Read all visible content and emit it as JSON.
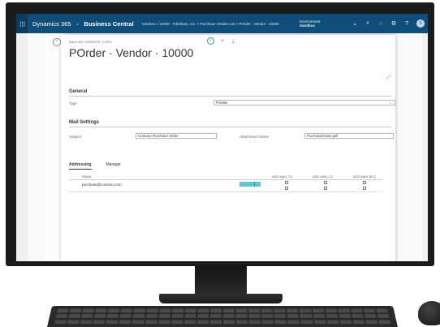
{
  "app": {
    "brand": "Dynamics 365",
    "product": "Business Central",
    "breadcrumb": "Vendors > 10000 · Fabrikam, Inc. > Purchase Vendor List > POrder · Vendor · 10000",
    "company_label": "Environment",
    "company": "Sandbox",
    "avatar_initial": "S"
  },
  "card": {
    "caption": "MAILING VENDOR CARD",
    "title": "POrder · Vendor · 10000"
  },
  "general": {
    "heading": "General",
    "type_label": "Type",
    "type_value": "POrder"
  },
  "mail_settings": {
    "heading": "Mail Settings",
    "subject_label": "Subject",
    "subject_value": "Contoso Purchase Order",
    "attachment_label": "Attachment Name",
    "attachment_value": "PurchaseOrder.pdf"
  },
  "tabs": [
    {
      "label": "Addressing"
    },
    {
      "label": "Manage"
    }
  ],
  "addressing_table": {
    "columns": [
      "EMAIL",
      "ADD MAIL TO",
      "ADD MAIL CC",
      "ADD MAIL BCC"
    ],
    "rows": [
      {
        "email": "purchase@contoso.com"
      },
      {
        "email": ""
      }
    ]
  },
  "colors": {
    "topbar": "#0f4e7a",
    "accent": "#2a9d8f",
    "selected_cell": "#5ec9d1"
  }
}
